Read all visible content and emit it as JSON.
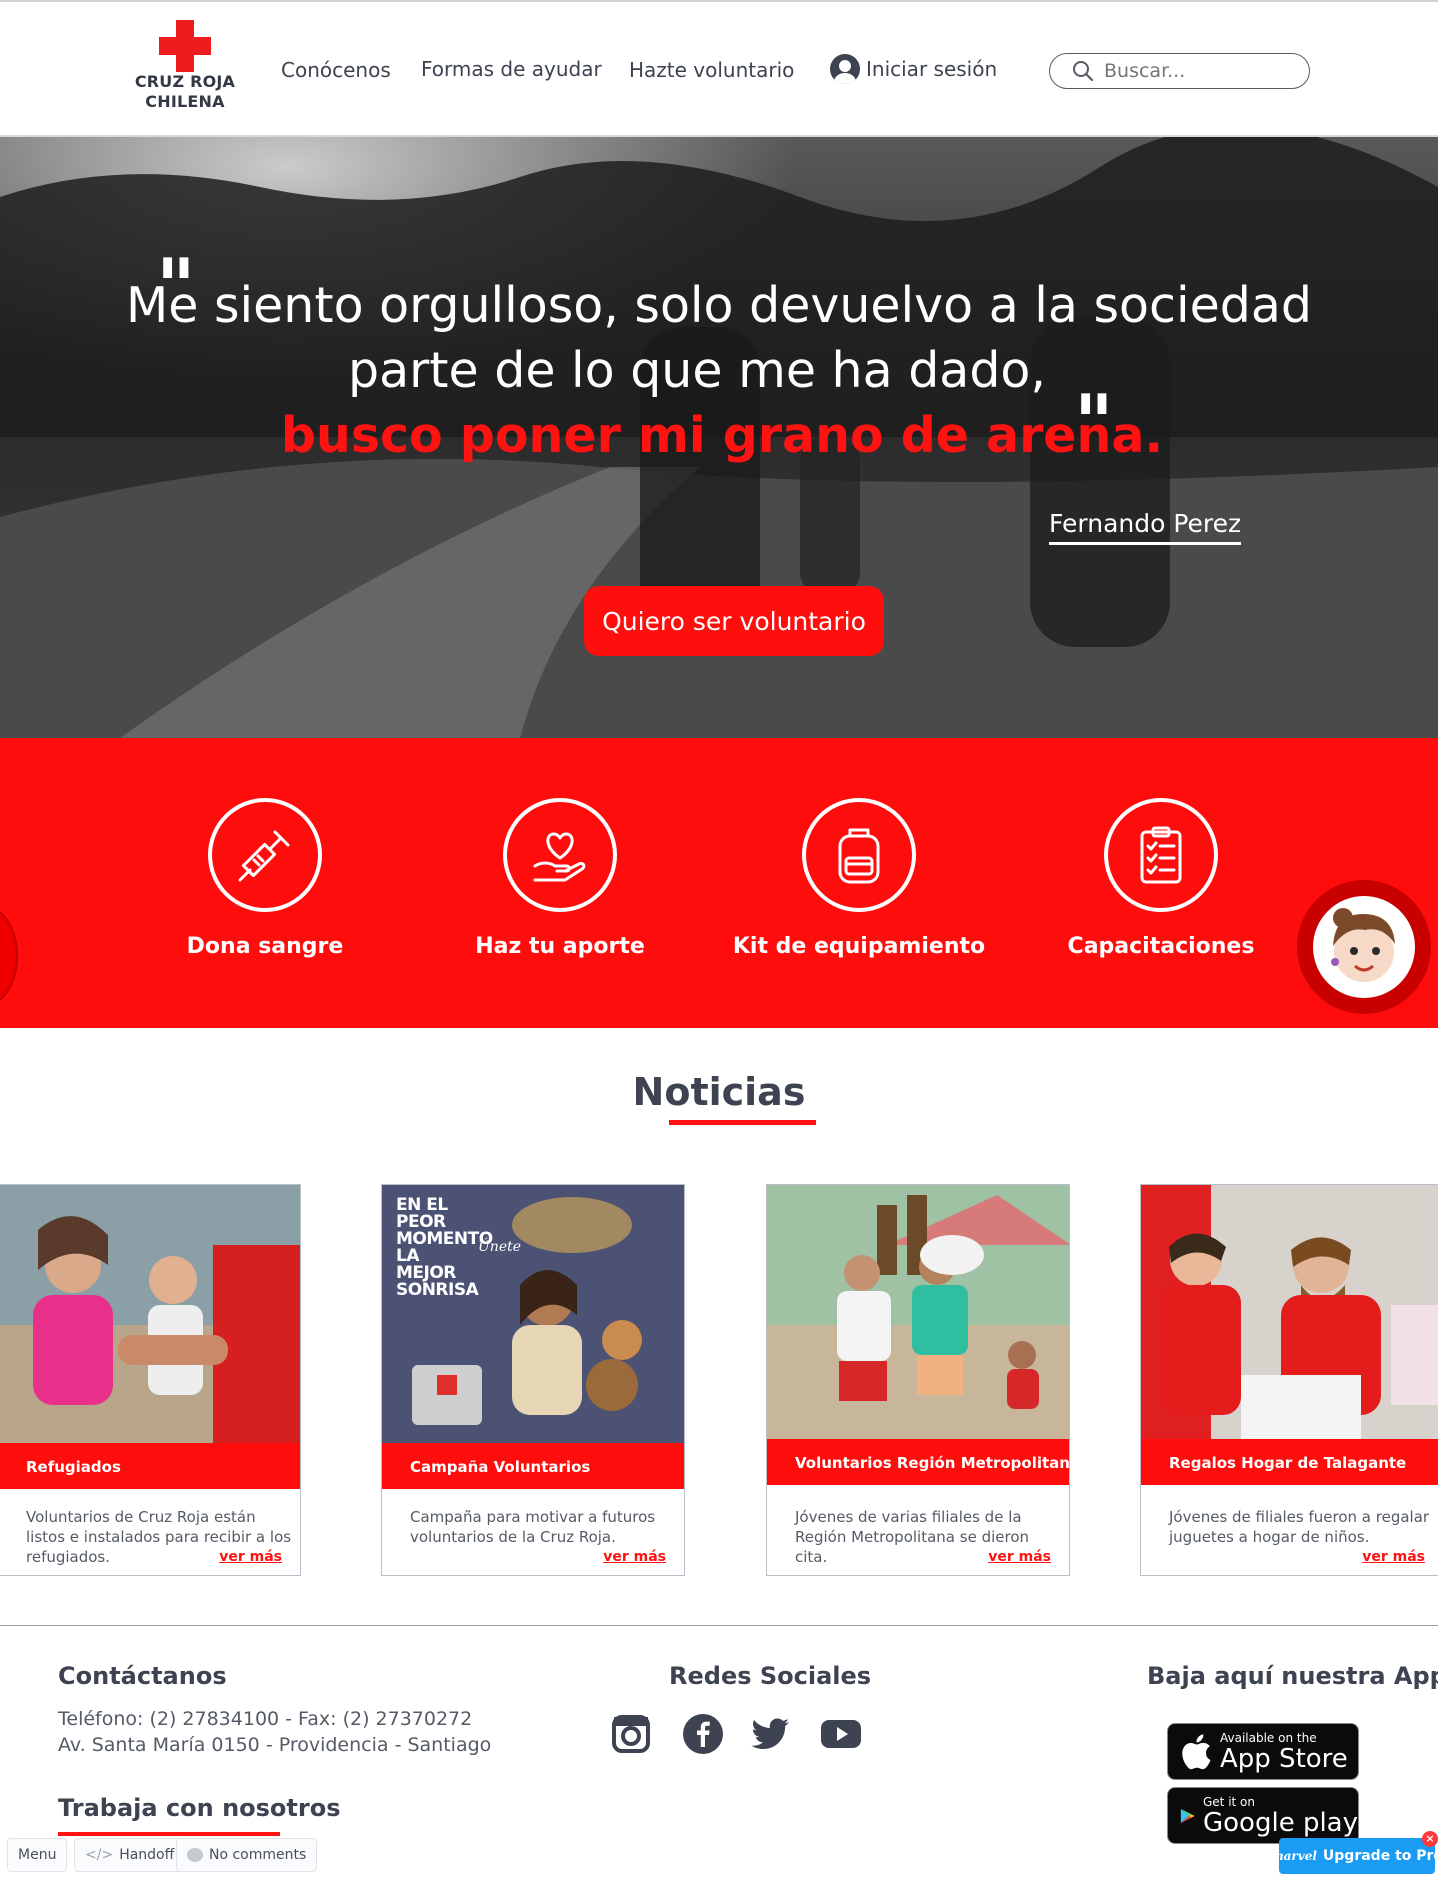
{
  "header": {
    "logo_line1": "CRUZ ROJA",
    "logo_line2": "CHILENA",
    "nav": [
      "Conócenos",
      "Formas de ayudar",
      "Hazte voluntario"
    ],
    "login_label": "Iniciar sesión",
    "search_placeholder": "Buscar..."
  },
  "hero": {
    "line1": "Me siento orgulloso, solo devuelvo a la sociedad",
    "line2": "parte de lo que me ha dado,",
    "line3": "busco poner mi grano de arena.",
    "author": "Fernando Perez",
    "cta": "Quiero ser voluntario"
  },
  "services": [
    {
      "label": "Dona sangre",
      "icon": "syringe-icon"
    },
    {
      "label": "Haz tu aporte",
      "icon": "heart-hand-icon"
    },
    {
      "label": "Kit de equipamiento",
      "icon": "backpack-icon"
    },
    {
      "label": "Capacitaciones",
      "icon": "clipboard-icon"
    }
  ],
  "news": {
    "title": "Noticias",
    "more_label": "ver más",
    "cards": [
      {
        "tag": "Refugiados",
        "desc": "Voluntarios de Cruz Roja están listos e instalados para recibir a los refugiados."
      },
      {
        "tag": "Campaña Voluntarios",
        "desc": "Campaña para motivar a futuros voluntarios de la Cruz Roja.",
        "poster_title": "EN EL PEOR MOMENTO LA MEJOR SONRISA",
        "poster_cta": "Únete"
      },
      {
        "tag": "Voluntarios Región Metropolitana",
        "desc": "Jóvenes de varias filiales de la Región Metropolitana se dieron cita."
      },
      {
        "tag": "Regalos Hogar de  Talagante",
        "desc": "Jóvenes de filiales fueron a regalar juguetes a hogar de niños."
      }
    ]
  },
  "footer": {
    "contact_title": "Contáctanos",
    "phone": "Teléfono: (2) 27834100 - Fax: (2) 27370272",
    "address": "Av. Santa María 0150 - Providencia - Santiago",
    "work_title": "Trabaja con nosotros",
    "social_title": "Redes Sociales",
    "app_title": "Baja aquí nuestra App",
    "appstore_small": "Available on the",
    "appstore_big": "App Store",
    "googleplay_small": "Get it on",
    "googleplay_big": "Google play"
  },
  "toolbar": {
    "menu": "Menu",
    "handoff": "Handoff",
    "comments": "No comments",
    "upgrade": "Upgrade to Pro",
    "brand": "marvel"
  },
  "colors": {
    "accent": "#ff0c0c",
    "text": "#3d4350",
    "pro_button": "#1a9cf4"
  }
}
